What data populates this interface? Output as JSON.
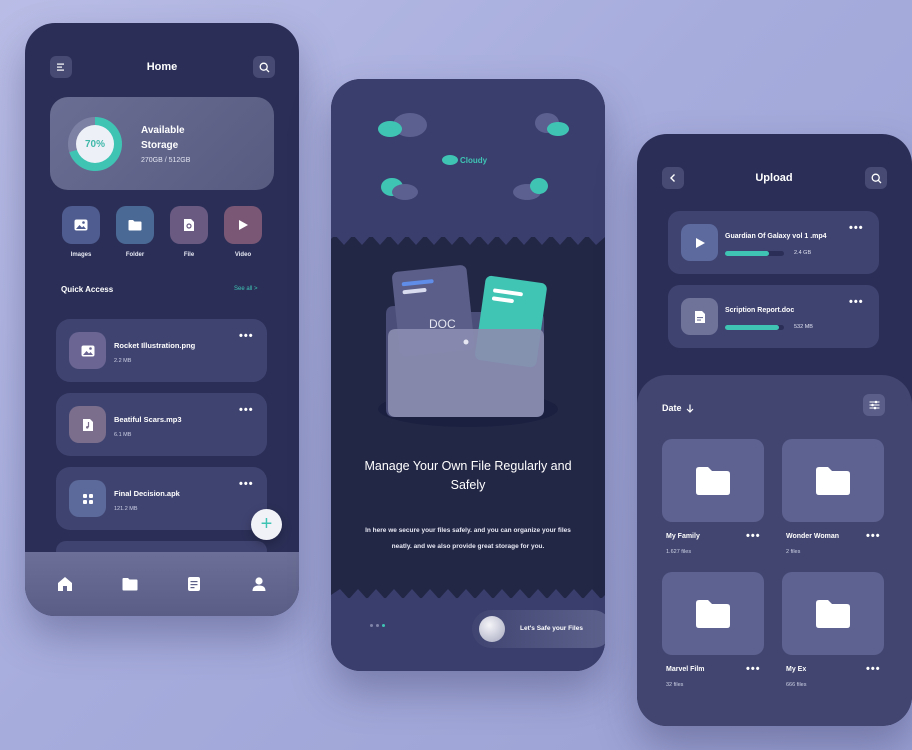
{
  "colors": {
    "accent": "#3fc4b4",
    "panel": "#2b2f57",
    "card": "#3f4370"
  },
  "home": {
    "title": "Home",
    "menu_icon": "menu-icon",
    "search_icon": "search-icon",
    "storage": {
      "percent": "70%",
      "percent_value": 70,
      "title": "Available Storage",
      "amount": "270GB / 512GB"
    },
    "categories": [
      {
        "label": "Images",
        "icon": "image-icon",
        "color": "#4f5c8f"
      },
      {
        "label": "Folder",
        "icon": "folder-icon",
        "color": "#4a6a95"
      },
      {
        "label": "File",
        "icon": "file-icon",
        "color": "#6a5a82"
      },
      {
        "label": "Video",
        "icon": "play-icon",
        "color": "#7a5775"
      }
    ],
    "quick_access": {
      "title": "Quick Access",
      "see_all": "See all >"
    },
    "files": [
      {
        "name": "Rocket Illustration.png",
        "size": "2.2 MB",
        "icon": "image-icon"
      },
      {
        "name": "Beatiful Scars.mp3",
        "size": "6.1 MB",
        "icon": "music-icon"
      },
      {
        "name": "Final Decision.apk",
        "size": "121.2 MB",
        "icon": "grid-icon"
      }
    ],
    "tabs": [
      "home-icon",
      "folder-icon",
      "document-icon",
      "profile-icon"
    ]
  },
  "onboarding": {
    "weather": "Cloudy",
    "illustration_label": "DOC",
    "title": "Manage Your Own File Regularly and Safely",
    "text": "In here we secure your files safely. and you can organize your files neatly. and we also provide great storage for you.",
    "cta": "Let's Safe your Files"
  },
  "upload": {
    "title": "Upload",
    "uploads": [
      {
        "name": "Guardian Of Galaxy vol 1 .mp4",
        "size": "2.4 GB",
        "progress": 0.75,
        "icon": "play-icon"
      },
      {
        "name": "Scription Report.doc",
        "size": "532 MB",
        "progress": 0.92,
        "icon": "doc-icon"
      }
    ],
    "sort": "Date",
    "folders": [
      {
        "name": "My Family",
        "count": "1.627 files"
      },
      {
        "name": "Wonder Woman",
        "count": "2 files"
      },
      {
        "name": "Marvel Film",
        "count": "32 files"
      },
      {
        "name": "My Ex",
        "count": "666 files"
      }
    ]
  }
}
